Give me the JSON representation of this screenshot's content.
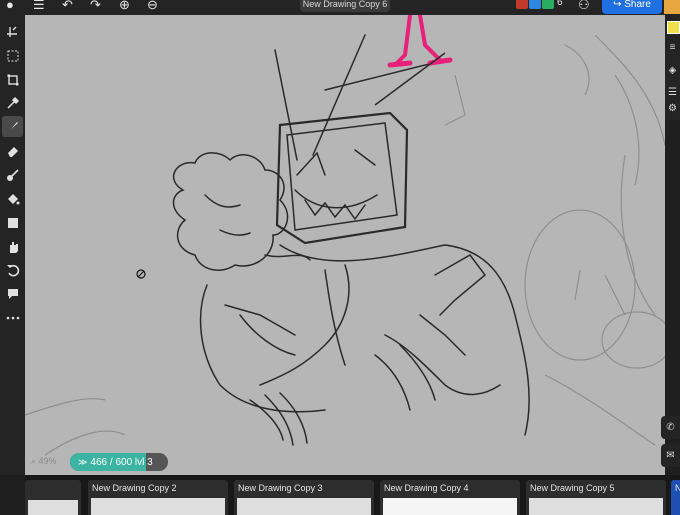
{
  "header": {
    "title": "New Drawing Copy 6",
    "collaborator_count": "6",
    "share_label": "Share"
  },
  "toolbar_icons": [
    "transform-icon",
    "select-icon",
    "crop-icon",
    "eyedropper-icon",
    "brush-icon",
    "eraser-icon",
    "smudge-icon",
    "fill-icon",
    "shape-icon",
    "hand-icon",
    "undo-icon",
    "comment-icon",
    "more-icon"
  ],
  "colors": {
    "accent": "#1f6fe0",
    "frame_counter": "#3cb4a2",
    "canvas": "#b6b6b6"
  },
  "status": {
    "zoom": "49%",
    "frame_counter": "466 / 600",
    "layer": "lvl 3",
    "frame_progress": 0.7767
  },
  "filmstrip": {
    "items": [
      {
        "label": ""
      },
      {
        "label": "New Drawing Copy 2"
      },
      {
        "label": "New Drawing Copy 3"
      },
      {
        "label": "New Drawing Copy 4"
      },
      {
        "label": "New Drawing Copy 5"
      },
      {
        "label": "N"
      }
    ]
  }
}
